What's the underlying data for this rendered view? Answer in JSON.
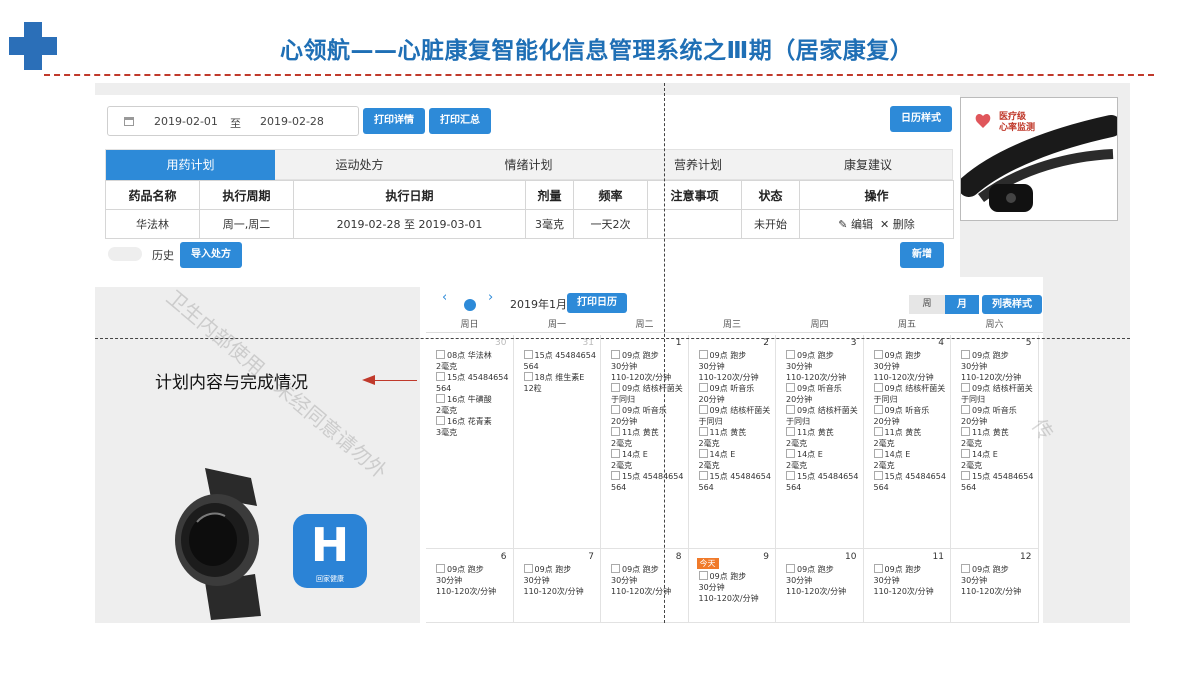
{
  "slide": {
    "title": "心领航——心脏康复智能化信息管理系统之Ⅲ期（居家康复）",
    "brand_color": "#1f6fb5",
    "accent_color": "#2d8ad8",
    "cross_icon": "medical-cross-icon"
  },
  "filter": {
    "date_from": "2019-02-01",
    "separator": "至",
    "date_to": "2019-02-28",
    "date_icon": "calendar-icon",
    "print_detail_label": "打印详情",
    "print_summary_label": "打印汇总",
    "calendar_style_label": "日历样式"
  },
  "tabs": [
    "用药计划",
    "运动处方",
    "情绪计划",
    "营养计划",
    "康复建议"
  ],
  "medication": {
    "headers": [
      "药品名称",
      "执行周期",
      "执行日期",
      "剂量",
      "频率",
      "注意事项",
      "状态",
      "操作"
    ],
    "row": {
      "name": "华法林",
      "cycle": "周一,周二",
      "dates": "2019-02-28 至 2019-03-01",
      "dose": "3毫克",
      "freq": "一天2次",
      "note": "",
      "status": "未开始",
      "edit_label": "编辑",
      "delete_label": "删除"
    }
  },
  "history": {
    "label": "历史",
    "import_label": "导入处方",
    "add_label": "新增"
  },
  "device": {
    "monitor_label_1": "医疗级",
    "monitor_label_2": "心率监测"
  },
  "calendar": {
    "month_label": "2019年1月",
    "print_calendar_label": "打印日历",
    "view_week": "周",
    "view_month": "月",
    "view_list": "列表样式",
    "weekdays": [
      "周日",
      "周一",
      "周二",
      "周三",
      "周四",
      "周五",
      "周六"
    ],
    "week1": [
      {
        "day": "30",
        "dim": true,
        "items": [
          "08点 华法林",
          "2毫克",
          "15点 45484654564",
          "16点 牛磺酸",
          "2毫克",
          "16点 花青素",
          "3毫克"
        ]
      },
      {
        "day": "31",
        "dim": true,
        "items": [
          "15点 45484654564",
          "18点 维生素E",
          "12粒"
        ]
      },
      {
        "day": "1",
        "items": [
          "09点 跑步",
          "30分钟",
          "110-120次/分钟",
          "09点 结核杆菌关于同归",
          "09点 听音乐",
          "20分钟",
          "11点 黄芪",
          "2毫克",
          "14点 E",
          "2毫克",
          "15点 45484654564"
        ]
      },
      {
        "day": "2",
        "items": [
          "09点 跑步",
          "30分钟",
          "110-120次/分钟",
          "09点 听音乐",
          "20分钟",
          "09点 结核杆菌关于同归",
          "11点 黄芪",
          "2毫克",
          "14点 E",
          "2毫克",
          "15点 45484654564"
        ]
      },
      {
        "day": "3",
        "items": [
          "09点 跑步",
          "30分钟",
          "110-120次/分钟",
          "09点 听音乐",
          "20分钟",
          "09点 结核杆菌关于同归",
          "11点 黄芪",
          "2毫克",
          "14点 E",
          "2毫克",
          "15点 45484654564"
        ]
      },
      {
        "day": "4",
        "items": [
          "09点 跑步",
          "30分钟",
          "110-120次/分钟",
          "09点 结核杆菌关于同归",
          "09点 听音乐",
          "20分钟",
          "11点 黄芪",
          "2毫克",
          "14点 E",
          "2毫克",
          "15点 45484654564"
        ]
      },
      {
        "day": "5",
        "items": [
          "09点 跑步",
          "30分钟",
          "110-120次/分钟",
          "09点 结核杆菌关于同归",
          "09点 听音乐",
          "20分钟",
          "11点 黄芪",
          "2毫克",
          "14点 E",
          "2毫克",
          "15点 45484654564"
        ]
      }
    ],
    "week2": [
      {
        "day": "6",
        "items": [
          "09点 跑步",
          "30分钟",
          "110-120次/分钟"
        ]
      },
      {
        "day": "7",
        "items": [
          "09点 跑步",
          "30分钟",
          "110-120次/分钟"
        ]
      },
      {
        "day": "8",
        "items": [
          "09点 跑步",
          "30分钟",
          "110-120次/分钟"
        ]
      },
      {
        "day": "9",
        "today": "今天",
        "items": [
          "09点 跑步",
          "30分钟",
          "110-120次/分钟"
        ]
      },
      {
        "day": "10",
        "items": [
          "09点 跑步",
          "30分钟",
          "110-120次/分钟"
        ]
      },
      {
        "day": "11",
        "items": [
          "09点 跑步",
          "30分钟",
          "110-120次/分钟"
        ]
      },
      {
        "day": "12",
        "items": [
          "09点 跑步",
          "30分钟",
          "110-120次/分钟"
        ]
      }
    ]
  },
  "callout": {
    "text": "计划内容与完成情况",
    "arrow_color": "#c0392b"
  },
  "app": {
    "icon_letter": "H",
    "label": "回家健康"
  },
  "watermark": {
    "left": "卫生内部使用，未经同意请勿外",
    "right": "传"
  }
}
